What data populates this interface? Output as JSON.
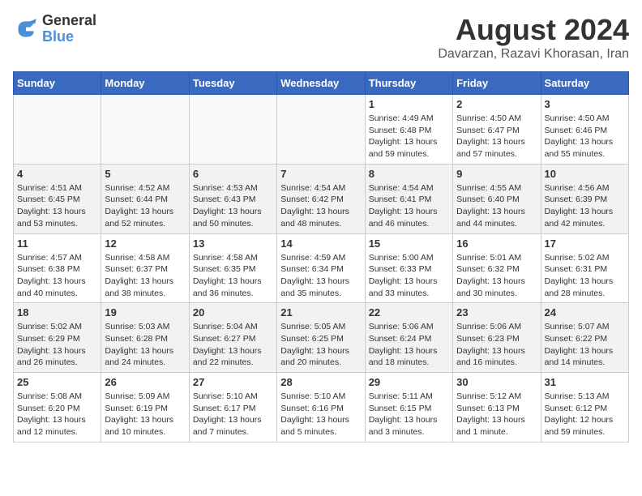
{
  "header": {
    "logo_line1": "General",
    "logo_line2": "Blue",
    "month_title": "August 2024",
    "subtitle": "Davarzan, Razavi Khorasan, Iran"
  },
  "weekdays": [
    "Sunday",
    "Monday",
    "Tuesday",
    "Wednesday",
    "Thursday",
    "Friday",
    "Saturday"
  ],
  "weeks": [
    [
      {
        "day": "",
        "info": ""
      },
      {
        "day": "",
        "info": ""
      },
      {
        "day": "",
        "info": ""
      },
      {
        "day": "",
        "info": ""
      },
      {
        "day": "1",
        "info": "Sunrise: 4:49 AM\nSunset: 6:48 PM\nDaylight: 13 hours\nand 59 minutes."
      },
      {
        "day": "2",
        "info": "Sunrise: 4:50 AM\nSunset: 6:47 PM\nDaylight: 13 hours\nand 57 minutes."
      },
      {
        "day": "3",
        "info": "Sunrise: 4:50 AM\nSunset: 6:46 PM\nDaylight: 13 hours\nand 55 minutes."
      }
    ],
    [
      {
        "day": "4",
        "info": "Sunrise: 4:51 AM\nSunset: 6:45 PM\nDaylight: 13 hours\nand 53 minutes."
      },
      {
        "day": "5",
        "info": "Sunrise: 4:52 AM\nSunset: 6:44 PM\nDaylight: 13 hours\nand 52 minutes."
      },
      {
        "day": "6",
        "info": "Sunrise: 4:53 AM\nSunset: 6:43 PM\nDaylight: 13 hours\nand 50 minutes."
      },
      {
        "day": "7",
        "info": "Sunrise: 4:54 AM\nSunset: 6:42 PM\nDaylight: 13 hours\nand 48 minutes."
      },
      {
        "day": "8",
        "info": "Sunrise: 4:54 AM\nSunset: 6:41 PM\nDaylight: 13 hours\nand 46 minutes."
      },
      {
        "day": "9",
        "info": "Sunrise: 4:55 AM\nSunset: 6:40 PM\nDaylight: 13 hours\nand 44 minutes."
      },
      {
        "day": "10",
        "info": "Sunrise: 4:56 AM\nSunset: 6:39 PM\nDaylight: 13 hours\nand 42 minutes."
      }
    ],
    [
      {
        "day": "11",
        "info": "Sunrise: 4:57 AM\nSunset: 6:38 PM\nDaylight: 13 hours\nand 40 minutes."
      },
      {
        "day": "12",
        "info": "Sunrise: 4:58 AM\nSunset: 6:37 PM\nDaylight: 13 hours\nand 38 minutes."
      },
      {
        "day": "13",
        "info": "Sunrise: 4:58 AM\nSunset: 6:35 PM\nDaylight: 13 hours\nand 36 minutes."
      },
      {
        "day": "14",
        "info": "Sunrise: 4:59 AM\nSunset: 6:34 PM\nDaylight: 13 hours\nand 35 minutes."
      },
      {
        "day": "15",
        "info": "Sunrise: 5:00 AM\nSunset: 6:33 PM\nDaylight: 13 hours\nand 33 minutes."
      },
      {
        "day": "16",
        "info": "Sunrise: 5:01 AM\nSunset: 6:32 PM\nDaylight: 13 hours\nand 30 minutes."
      },
      {
        "day": "17",
        "info": "Sunrise: 5:02 AM\nSunset: 6:31 PM\nDaylight: 13 hours\nand 28 minutes."
      }
    ],
    [
      {
        "day": "18",
        "info": "Sunrise: 5:02 AM\nSunset: 6:29 PM\nDaylight: 13 hours\nand 26 minutes."
      },
      {
        "day": "19",
        "info": "Sunrise: 5:03 AM\nSunset: 6:28 PM\nDaylight: 13 hours\nand 24 minutes."
      },
      {
        "day": "20",
        "info": "Sunrise: 5:04 AM\nSunset: 6:27 PM\nDaylight: 13 hours\nand 22 minutes."
      },
      {
        "day": "21",
        "info": "Sunrise: 5:05 AM\nSunset: 6:25 PM\nDaylight: 13 hours\nand 20 minutes."
      },
      {
        "day": "22",
        "info": "Sunrise: 5:06 AM\nSunset: 6:24 PM\nDaylight: 13 hours\nand 18 minutes."
      },
      {
        "day": "23",
        "info": "Sunrise: 5:06 AM\nSunset: 6:23 PM\nDaylight: 13 hours\nand 16 minutes."
      },
      {
        "day": "24",
        "info": "Sunrise: 5:07 AM\nSunset: 6:22 PM\nDaylight: 13 hours\nand 14 minutes."
      }
    ],
    [
      {
        "day": "25",
        "info": "Sunrise: 5:08 AM\nSunset: 6:20 PM\nDaylight: 13 hours\nand 12 minutes."
      },
      {
        "day": "26",
        "info": "Sunrise: 5:09 AM\nSunset: 6:19 PM\nDaylight: 13 hours\nand 10 minutes."
      },
      {
        "day": "27",
        "info": "Sunrise: 5:10 AM\nSunset: 6:17 PM\nDaylight: 13 hours\nand 7 minutes."
      },
      {
        "day": "28",
        "info": "Sunrise: 5:10 AM\nSunset: 6:16 PM\nDaylight: 13 hours\nand 5 minutes."
      },
      {
        "day": "29",
        "info": "Sunrise: 5:11 AM\nSunset: 6:15 PM\nDaylight: 13 hours\nand 3 minutes."
      },
      {
        "day": "30",
        "info": "Sunrise: 5:12 AM\nSunset: 6:13 PM\nDaylight: 13 hours\nand 1 minute."
      },
      {
        "day": "31",
        "info": "Sunrise: 5:13 AM\nSunset: 6:12 PM\nDaylight: 12 hours\nand 59 minutes."
      }
    ]
  ]
}
